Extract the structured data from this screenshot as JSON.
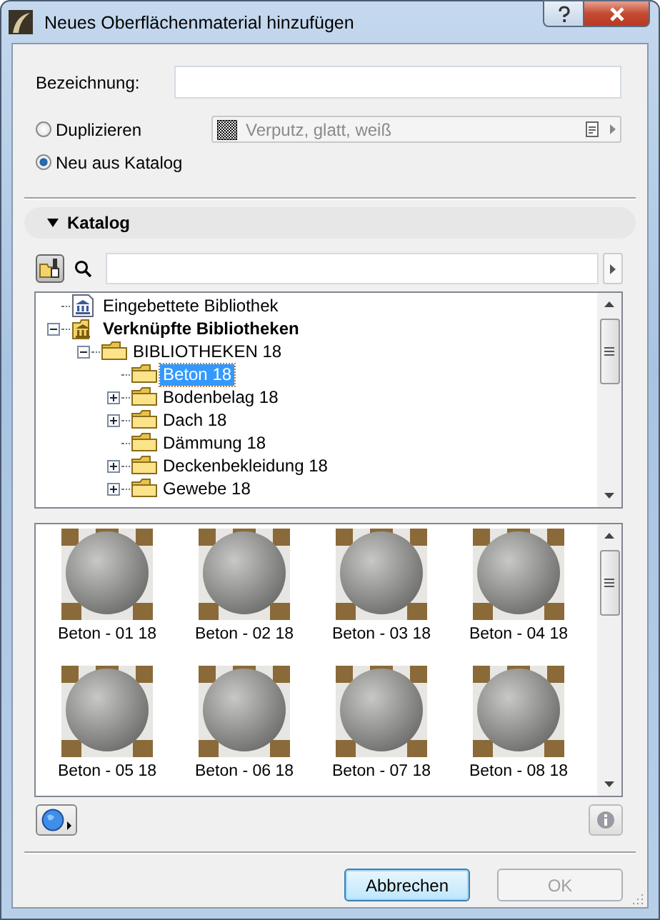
{
  "window": {
    "title": "Neues Oberflächenmaterial hinzufügen"
  },
  "name_field": {
    "label": "Bezeichnung:"
  },
  "source_options": [
    {
      "label": "Duplizieren",
      "selected": false
    },
    {
      "label": "Neu aus Katalog",
      "selected": true
    }
  ],
  "duplicate_material": {
    "value": "Verputz, glatt, weiß",
    "disabled": true
  },
  "catalog": {
    "title": "Katalog",
    "expanded": true,
    "tree": [
      {
        "label": "Eingebettete Bibliothek",
        "kind": "embedded-library",
        "selected": false
      },
      {
        "label": "Verknüpfte Bibliotheken",
        "kind": "linked-library",
        "selected": false,
        "expanded": true,
        "children": [
          {
            "label": "BIBLIOTHEKEN 18",
            "kind": "folder",
            "selected": false,
            "expanded": true,
            "children": [
              {
                "label": "Beton 18",
                "kind": "folder",
                "selected": true
              },
              {
                "label": "Bodenbelag 18",
                "kind": "folder",
                "selected": false,
                "expanded": false
              },
              {
                "label": "Dach 18",
                "kind": "folder",
                "selected": false,
                "expanded": false
              },
              {
                "label": "Dämmung 18",
                "kind": "folder",
                "selected": false
              },
              {
                "label": "Deckenbekleidung 18",
                "kind": "folder",
                "selected": false,
                "expanded": false
              },
              {
                "label": "Gewebe 18",
                "kind": "folder",
                "selected": false,
                "expanded": false
              }
            ]
          }
        ]
      }
    ],
    "materials": [
      {
        "label": "Beton - 01 18"
      },
      {
        "label": "Beton - 02 18"
      },
      {
        "label": "Beton - 03 18"
      },
      {
        "label": "Beton - 04 18"
      },
      {
        "label": "Beton - 05 18"
      },
      {
        "label": "Beton - 06 18"
      },
      {
        "label": "Beton - 07 18"
      },
      {
        "label": "Beton - 08 18"
      }
    ]
  },
  "buttons": [
    {
      "label": "Abbrechen",
      "disabled": false
    },
    {
      "label": "OK",
      "disabled": true
    }
  ]
}
